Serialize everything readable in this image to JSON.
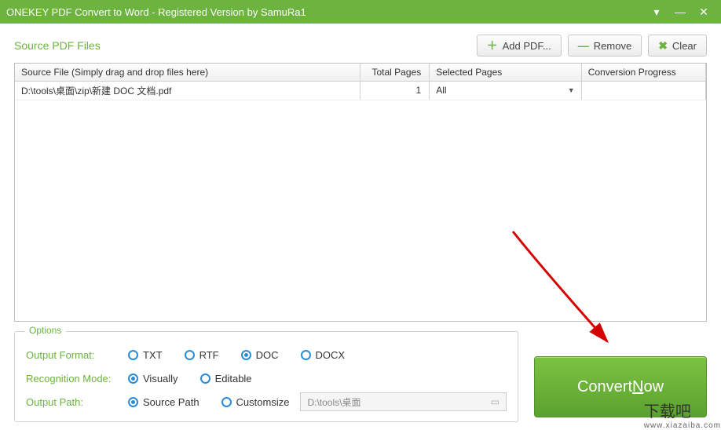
{
  "title": "ONEKEY PDF Convert to Word - Registered Version by SamuRa1",
  "source_title": "Source PDF Files",
  "buttons": {
    "add": "Add PDF...",
    "remove": "Remove",
    "clear": "Clear"
  },
  "table": {
    "headers": {
      "src": "Source File (Simply drag and drop files here)",
      "tp": "Total Pages",
      "sel": "Selected Pages",
      "prog": "Conversion Progress"
    },
    "row": {
      "src": "D:\\tools\\桌面\\zip\\新建 DOC 文档.pdf",
      "tp": "1",
      "sel": "All",
      "prog": ""
    }
  },
  "options": {
    "legend": "Options",
    "format_label": "Output Format:",
    "formats": {
      "txt": "TXT",
      "rtf": "RTF",
      "doc": "DOC",
      "docx": "DOCX"
    },
    "format_selected": "doc",
    "recog_label": "Recognition Mode:",
    "recog": {
      "visually": "Visually",
      "editable": "Editable"
    },
    "recog_selected": "visually",
    "path_label": "Output Path:",
    "path_opts": {
      "source": "Source Path",
      "custom": "Customsize"
    },
    "path_selected": "source",
    "path_value": "D:\\tools\\桌面"
  },
  "convert": {
    "prefix": "Convert ",
    "key": "N",
    "suffix": "ow"
  },
  "watermark": {
    "cn": "下载吧",
    "url": "www.xiazaiba.com"
  }
}
